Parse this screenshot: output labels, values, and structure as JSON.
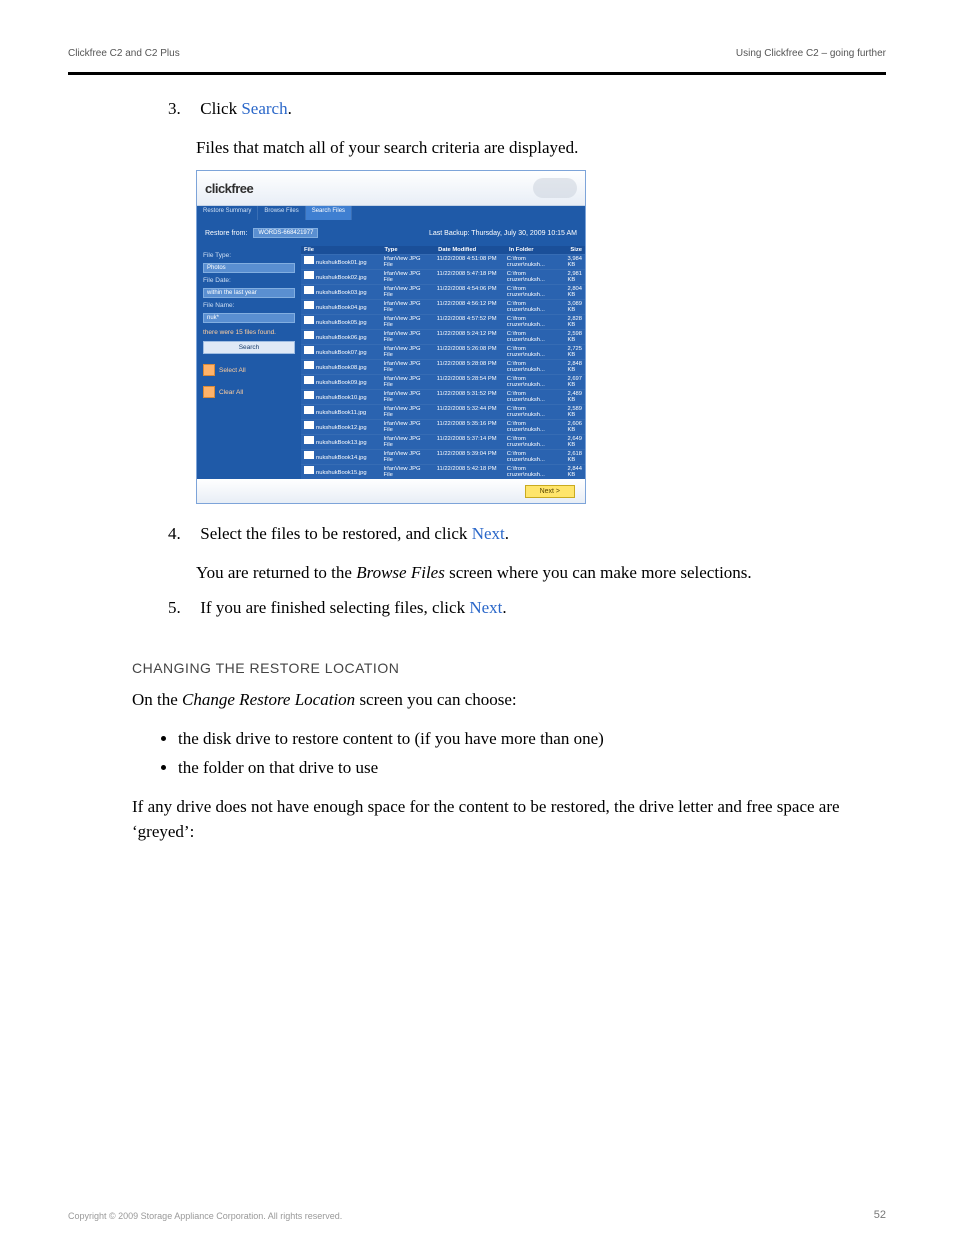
{
  "header": {
    "doc_title": "Clickfree C2 and C2 Plus",
    "section": "Using Clickfree C2 – going further"
  },
  "steps": [
    {
      "num": "3.",
      "text_a": "Click ",
      "link": "Search",
      "text_b": ".",
      "result": "Files that match all of your search criteria are displayed."
    },
    {
      "num": "4.",
      "text_a": "Select the files to be restored, and click ",
      "link": "Next",
      "text_b": ".",
      "result_a": "You are returned to the ",
      "screen": "Browse Files",
      "result_b": " screen where you can make more selections."
    },
    {
      "num": "5.",
      "text_a": "If you are finished selecting files, click ",
      "link": "Next",
      "text_b": "."
    }
  ],
  "subsection": {
    "heading": "CHANGING THE RESTORE LOCATION",
    "intro_a": "On the ",
    "screen": "Change Restore Location",
    "intro_b": " screen you can choose:",
    "bullets": [
      "the disk drive to restore content to (if you have more than one)",
      "the folder on that drive to use"
    ],
    "greyed": "If any drive does not have enough space for the content to be restored, the drive letter and free space are ‘greyed’:"
  },
  "shot": {
    "logo": "clickfree",
    "tabs": [
      "Restore Summary",
      "Browse Files",
      "Search Files"
    ],
    "toolbar": {
      "restore_from": "Restore from:",
      "restore_from_value": "WORDS-668421977",
      "last_backup": "Last Backup: Thursday, July 30, 2009 10:15 AM"
    },
    "side": {
      "file_type_lbl": "File Type:",
      "file_type_val": "Photos",
      "file_date_lbl": "File Date:",
      "file_date_val": "within the last year",
      "file_name_lbl": "File Name:",
      "file_name_val": "nuk*",
      "result": "there were 15 files found.",
      "search_btn": "Search",
      "select_all": "Select All",
      "clear_all": "Clear All"
    },
    "table": {
      "cols": [
        "File",
        "Type",
        "Date Modified",
        "In Folder",
        "Size"
      ],
      "rows": [
        {
          "file": "nukshukBook01.jpg",
          "type": "IrfanView JPG File",
          "date": "11/22/2008 4:51:08 PM",
          "folder": "C:\\from cruzer\\nuksh...",
          "size": "3,984 KB"
        },
        {
          "file": "nukshukBook02.jpg",
          "type": "IrfanView JPG File",
          "date": "11/22/2008 5:47:18 PM",
          "folder": "C:\\from cruzer\\nuksh...",
          "size": "2,981 KB"
        },
        {
          "file": "nukshukBook03.jpg",
          "type": "IrfanView JPG File",
          "date": "11/22/2008 4:54:06 PM",
          "folder": "C:\\from cruzer\\nuksh...",
          "size": "2,804 KB"
        },
        {
          "file": "nukshukBook04.jpg",
          "type": "IrfanView JPG File",
          "date": "11/22/2008 4:56:12 PM",
          "folder": "C:\\from cruzer\\nuksh...",
          "size": "3,089 KB"
        },
        {
          "file": "nukshukBook05.jpg",
          "type": "IrfanView JPG File",
          "date": "11/22/2008 4:57:52 PM",
          "folder": "C:\\from cruzer\\nuksh...",
          "size": "2,828 KB"
        },
        {
          "file": "nukshukBook06.jpg",
          "type": "IrfanView JPG File",
          "date": "11/22/2008 5:24:12 PM",
          "folder": "C:\\from cruzer\\nuksh...",
          "size": "2,598 KB"
        },
        {
          "file": "nukshukBook07.jpg",
          "type": "IrfanView JPG File",
          "date": "11/22/2008 5:26:08 PM",
          "folder": "C:\\from cruzer\\nuksh...",
          "size": "2,725 KB"
        },
        {
          "file": "nukshukBook08.jpg",
          "type": "IrfanView JPG File",
          "date": "11/22/2008 5:28:08 PM",
          "folder": "C:\\from cruzer\\nuksh...",
          "size": "2,848 KB"
        },
        {
          "file": "nukshukBook09.jpg",
          "type": "IrfanView JPG File",
          "date": "11/22/2008 5:28:54 PM",
          "folder": "C:\\from cruzer\\nuksh...",
          "size": "2,697 KB"
        },
        {
          "file": "nukshukBook10.jpg",
          "type": "IrfanView JPG File",
          "date": "11/22/2008 5:31:52 PM",
          "folder": "C:\\from cruzer\\nuksh...",
          "size": "2,489 KB"
        },
        {
          "file": "nukshukBook11.jpg",
          "type": "IrfanView JPG File",
          "date": "11/22/2008 5:32:44 PM",
          "folder": "C:\\from cruzer\\nuksh...",
          "size": "2,589 KB"
        },
        {
          "file": "nukshukBook12.jpg",
          "type": "IrfanView JPG File",
          "date": "11/22/2008 5:35:16 PM",
          "folder": "C:\\from cruzer\\nuksh...",
          "size": "2,606 KB"
        },
        {
          "file": "nukshukBook13.jpg",
          "type": "IrfanView JPG File",
          "date": "11/22/2008 5:37:14 PM",
          "folder": "C:\\from cruzer\\nuksh...",
          "size": "2,649 KB"
        },
        {
          "file": "nukshukBook14.jpg",
          "type": "IrfanView JPG File",
          "date": "11/22/2008 5:39:04 PM",
          "folder": "C:\\from cruzer\\nuksh...",
          "size": "2,618 KB"
        },
        {
          "file": "nukshukBook15.jpg",
          "type": "IrfanView JPG File",
          "date": "11/22/2008 5:42:18 PM",
          "folder": "C:\\from cruzer\\nuksh...",
          "size": "2,844 KB"
        }
      ]
    },
    "footer": {
      "next": "Next >"
    }
  },
  "footer": {
    "copyright": "Copyright © 2009 Storage Appliance Corporation. All rights reserved.",
    "page": "52"
  }
}
